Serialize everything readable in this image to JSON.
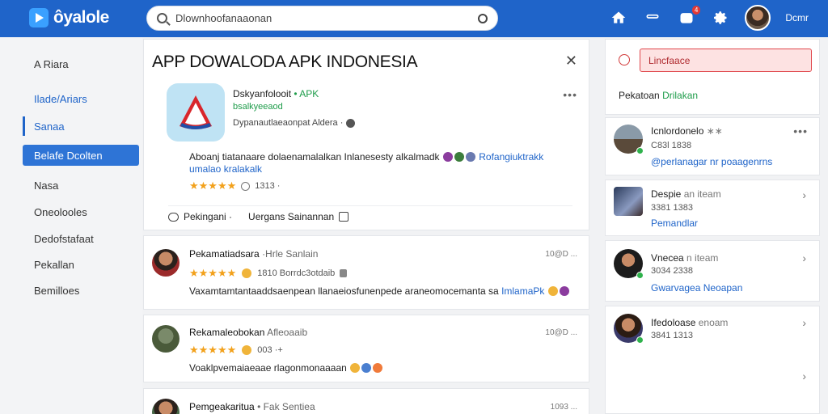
{
  "header": {
    "logo_text": "ôyalole",
    "search_value": "Dlownhoofanaaonan",
    "notif_count": "4",
    "user_name": "Dcmr"
  },
  "sidebar": {
    "items": [
      {
        "label": "A Riara"
      },
      {
        "label": "Ilade/Ariars"
      },
      {
        "label": "Sanaa"
      },
      {
        "label": "Belafe Dcolten"
      },
      {
        "label": "Nasa"
      },
      {
        "label": "Oneolooles"
      },
      {
        "label": "Dedofstafaat"
      },
      {
        "label": "Pekallan"
      },
      {
        "label": "Bemilloes"
      }
    ]
  },
  "app": {
    "title": "APP DOWALODA APK INDONESIA",
    "name": "Dskyanfolooit",
    "name_tag": "• APK",
    "developer": "bsalkyeeaod",
    "subtitle": "Dypanautlaeaonpat Aldera ·",
    "description": "Aboanj tiatanaare dolaenamalalkan Inlanesesty alkalmadk",
    "description_link1": "Rofangiuktrakk",
    "description_link2": "umalao kralakalk",
    "rating_count": "1313 ·",
    "action_comment": "Pekingani ·",
    "action_like": "Uergans Sainannan"
  },
  "reviews": [
    {
      "name": "Pekamatiadsara",
      "meta": "·Hrle Sanlain",
      "time": "10@D ...",
      "rating_text": "1810 Borrdc3otdaib",
      "text": "Vaxamtamtantaaddsaenpean llanaeiosfunenpede araneomocemanta sa",
      "link": "ImlamaPk"
    },
    {
      "name": "Rekamaleobokan",
      "meta": "Afleoaaib",
      "time": "10@D ...",
      "rating_text": "003 ·+",
      "text": "Voaklpvemaiaeaae rlagonmonaaaan"
    },
    {
      "name": "Pemgeakaritua",
      "meta": "• Fak Sentiea",
      "time": "1093 ..."
    }
  ],
  "right": {
    "report_label": "Lincfaace",
    "section_label": "Pekatoan",
    "section_label_green": "Drilakan",
    "items": [
      {
        "name": "Icnlordonelo",
        "meta": "∗∗",
        "sub": "C83l 1838",
        "link": "@perlanagar nr poaagenrns"
      },
      {
        "name": "Despie",
        "meta": "an iteam",
        "sub": "3381 1383",
        "link": "Pemandlar"
      },
      {
        "name": "Vnecea",
        "meta": "n iteam",
        "sub": "3034 2338",
        "link": "Gwarvagea Neoapan"
      },
      {
        "name": "Ifedoloase",
        "meta": "enoam",
        "sub": "3841 1313"
      }
    ]
  },
  "colors": {
    "brand": "#1f64c9",
    "green": "#1e9c4a",
    "star": "#f2a11c",
    "danger": "#e0474c"
  }
}
